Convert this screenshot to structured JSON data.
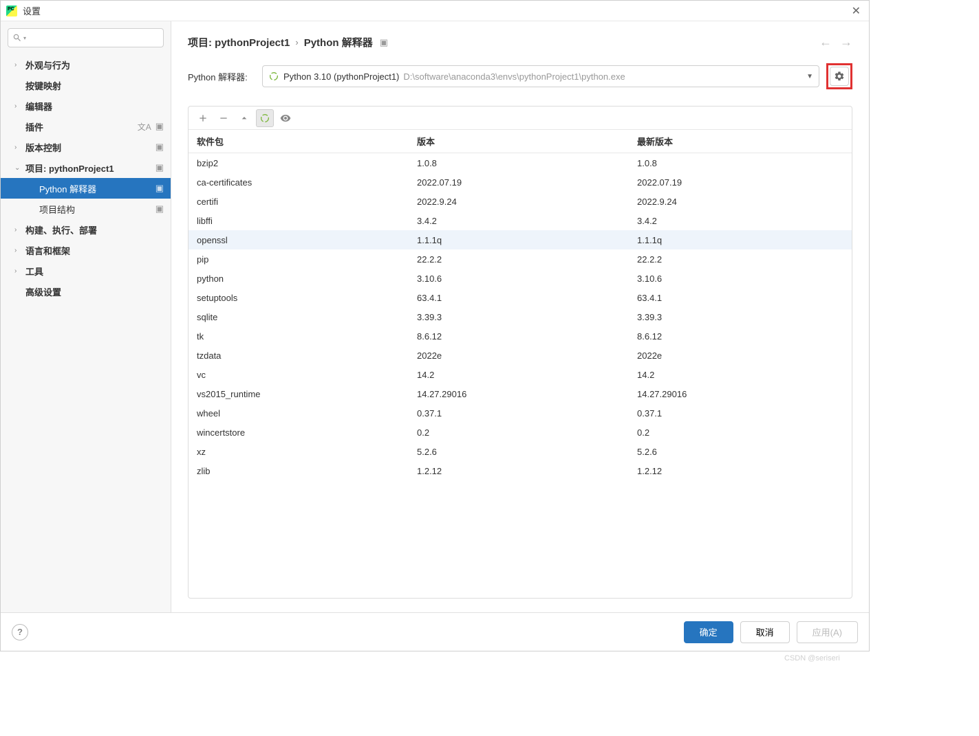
{
  "window": {
    "title": "设置"
  },
  "sidebar": {
    "items": [
      {
        "label": "外观与行为",
        "chevron": "›",
        "badges": []
      },
      {
        "label": "按键映射",
        "chevron": "",
        "badges": []
      },
      {
        "label": "编辑器",
        "chevron": "›",
        "badges": []
      },
      {
        "label": "插件",
        "chevron": "",
        "badges": [
          "translate",
          "project"
        ]
      },
      {
        "label": "版本控制",
        "chevron": "›",
        "badges": [
          "project"
        ]
      },
      {
        "label": "项目: pythonProject1",
        "chevron": "⌄",
        "badges": [
          "project"
        ],
        "children": [
          {
            "label": "Python 解释器",
            "badges": [
              "project"
            ],
            "selected": true
          },
          {
            "label": "项目结构",
            "badges": [
              "project"
            ]
          }
        ]
      },
      {
        "label": "构建、执行、部署",
        "chevron": "›",
        "badges": []
      },
      {
        "label": "语言和框架",
        "chevron": "›",
        "badges": []
      },
      {
        "label": "工具",
        "chevron": "›",
        "badges": []
      },
      {
        "label": "高级设置",
        "chevron": "",
        "badges": []
      }
    ]
  },
  "breadcrumb": {
    "part1": "项目: pythonProject1",
    "sep": "›",
    "part2": "Python 解释器"
  },
  "interpreter": {
    "label": "Python 解释器:",
    "name": "Python 3.10 (pythonProject1)",
    "path": "D:\\software\\anaconda3\\envs\\pythonProject1\\python.exe"
  },
  "packages": {
    "headers": {
      "name": "软件包",
      "version": "版本",
      "latest": "最新版本"
    },
    "rows": [
      {
        "name": "bzip2",
        "version": "1.0.8",
        "latest": "1.0.8"
      },
      {
        "name": "ca-certificates",
        "version": "2022.07.19",
        "latest": "2022.07.19"
      },
      {
        "name": "certifi",
        "version": "2022.9.24",
        "latest": "2022.9.24"
      },
      {
        "name": "libffi",
        "version": "3.4.2",
        "latest": "3.4.2"
      },
      {
        "name": "openssl",
        "version": "1.1.1q",
        "latest": "1.1.1q",
        "highlight": true
      },
      {
        "name": "pip",
        "version": "22.2.2",
        "latest": "22.2.2"
      },
      {
        "name": "python",
        "version": "3.10.6",
        "latest": "3.10.6"
      },
      {
        "name": "setuptools",
        "version": "63.4.1",
        "latest": "63.4.1"
      },
      {
        "name": "sqlite",
        "version": "3.39.3",
        "latest": "3.39.3"
      },
      {
        "name": "tk",
        "version": "8.6.12",
        "latest": "8.6.12"
      },
      {
        "name": "tzdata",
        "version": "2022e",
        "latest": "2022e"
      },
      {
        "name": "vc",
        "version": "14.2",
        "latest": "14.2"
      },
      {
        "name": "vs2015_runtime",
        "version": "14.27.29016",
        "latest": "14.27.29016"
      },
      {
        "name": "wheel",
        "version": "0.37.1",
        "latest": "0.37.1"
      },
      {
        "name": "wincertstore",
        "version": "0.2",
        "latest": "0.2"
      },
      {
        "name": "xz",
        "version": "5.2.6",
        "latest": "5.2.6"
      },
      {
        "name": "zlib",
        "version": "1.2.12",
        "latest": "1.2.12"
      }
    ]
  },
  "footer": {
    "ok": "确定",
    "cancel": "取消",
    "apply": "应用(A)"
  },
  "watermark": "CSDN @seriseri"
}
